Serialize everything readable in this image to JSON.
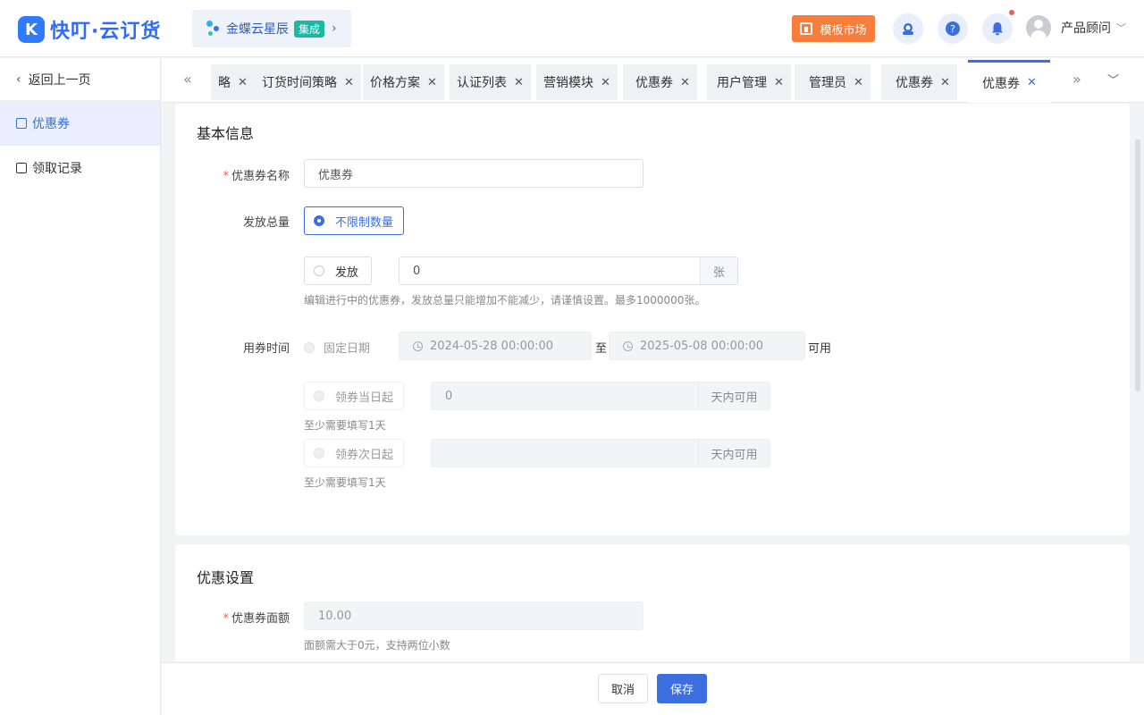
{
  "header": {
    "logo_text": "快叮·云订货",
    "integration_name": "金蝶云星辰",
    "integration_badge": "集成",
    "market_button": "模板市场",
    "user_name": "产品顾问"
  },
  "sidebar": {
    "back_label": "返回上一页",
    "items": [
      {
        "label": "优惠券",
        "active": true
      },
      {
        "label": "领取记录",
        "active": false
      }
    ]
  },
  "tabs": [
    {
      "label": "略",
      "active": false
    },
    {
      "label": "订货时间策略",
      "active": false
    },
    {
      "label": "价格方案",
      "active": false
    },
    {
      "label": "认证列表",
      "active": false
    },
    {
      "label": "营销模块",
      "active": false
    },
    {
      "label": "优惠券",
      "active": false
    },
    {
      "label": "用户管理",
      "active": false
    },
    {
      "label": "管理员",
      "active": false
    },
    {
      "label": "优惠券",
      "active": false
    },
    {
      "label": "优惠券",
      "active": true
    }
  ],
  "basic": {
    "title": "基本信息",
    "name_label": "优惠券名称",
    "name_value": "优惠券",
    "total_label": "发放总量",
    "unlimited_option": "不限制数量",
    "issue_option": "发放",
    "issue_value": "0",
    "issue_unit": "张",
    "total_hint": "编辑进行中的优惠券，发放总量只能增加不能减少，请谨慎设置。最多1000000张。",
    "time_label": "用券时间",
    "fixed_option": "固定日期",
    "start_date": "2024-05-28 00:00:00",
    "to_label": "至",
    "end_date": "2025-05-08 00:00:00",
    "available_label": "可用",
    "same_day_option": "领券当日起",
    "same_day_value": "0",
    "days_suffix": "天内可用",
    "min_day_hint": "至少需要填写1天",
    "next_day_option": "领券次日起",
    "next_day_value": "",
    "days_suffix2": "天内可用",
    "min_day_hint2": "至少需要填写1天"
  },
  "discount": {
    "title": "优惠设置",
    "face_label": "优惠券面额",
    "face_value": "10.00",
    "face_hint": "面额需大于0元，支持两位小数"
  },
  "footer": {
    "cancel": "取消",
    "save": "保存"
  },
  "colors": {
    "primary": "#3b6fe0",
    "market": "#f67e3a",
    "badge": "#1bb8a4",
    "required": "#f25b5b"
  }
}
